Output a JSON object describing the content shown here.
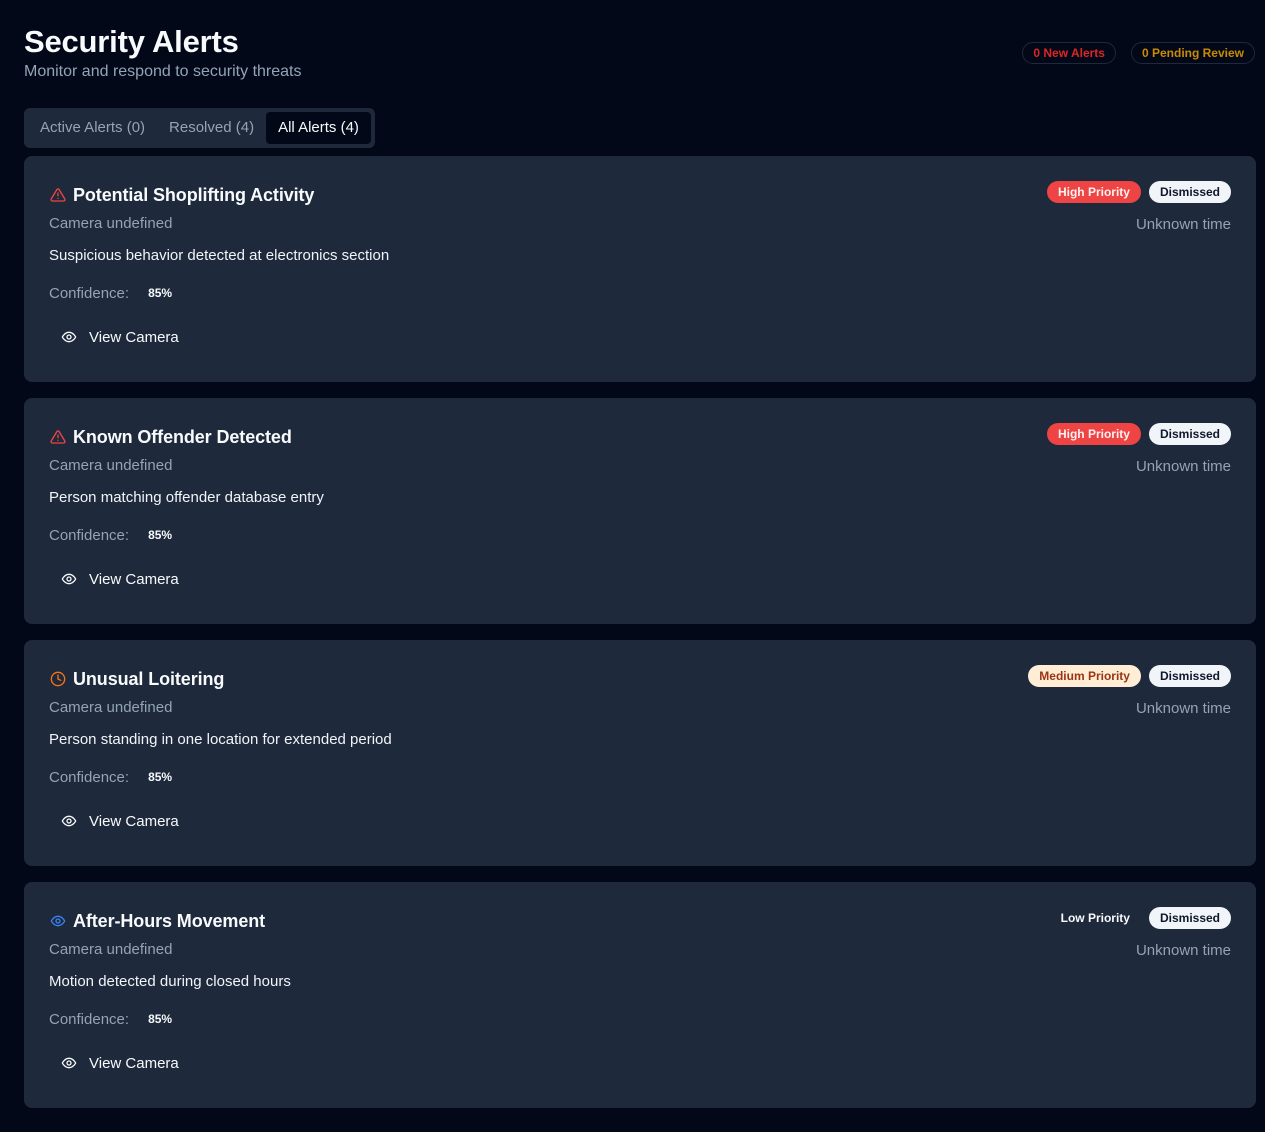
{
  "header": {
    "title": "Security Alerts",
    "subtitle": "Monitor and respond to security threats",
    "new_alerts": "0 New Alerts",
    "pending_review": "0 Pending Review"
  },
  "tabs": [
    {
      "label": "Active Alerts (0)",
      "active": false
    },
    {
      "label": "Resolved (4)",
      "active": false
    },
    {
      "label": "All Alerts (4)",
      "active": true
    }
  ],
  "alerts": [
    {
      "icon": "alert-triangle-icon",
      "icon_color": "#ef4444",
      "title": "Potential Shoplifting Activity",
      "camera": "Camera undefined",
      "description": "Suspicious behavior detected at electronics section",
      "confidence_label": "Confidence:",
      "confidence": "85%",
      "priority": "High Priority",
      "priority_level": "high",
      "status": "Dismissed",
      "time": "Unknown time",
      "action": "View Camera"
    },
    {
      "icon": "alert-triangle-icon",
      "icon_color": "#ef4444",
      "title": "Known Offender Detected",
      "camera": "Camera undefined",
      "description": "Person matching offender database entry",
      "confidence_label": "Confidence:",
      "confidence": "85%",
      "priority": "High Priority",
      "priority_level": "high",
      "status": "Dismissed",
      "time": "Unknown time",
      "action": "View Camera"
    },
    {
      "icon": "clock-icon",
      "icon_color": "#f97316",
      "title": "Unusual Loitering",
      "camera": "Camera undefined",
      "description": "Person standing in one location for extended period",
      "confidence_label": "Confidence:",
      "confidence": "85%",
      "priority": "Medium Priority",
      "priority_level": "medium",
      "status": "Dismissed",
      "time": "Unknown time",
      "action": "View Camera"
    },
    {
      "icon": "eye-icon",
      "icon_color": "#3b82f6",
      "title": "After-Hours Movement",
      "camera": "Camera undefined",
      "description": "Motion detected during closed hours",
      "confidence_label": "Confidence:",
      "confidence": "85%",
      "priority": "Low Priority",
      "priority_level": "low",
      "status": "Dismissed",
      "time": "Unknown time",
      "action": "View Camera"
    }
  ]
}
